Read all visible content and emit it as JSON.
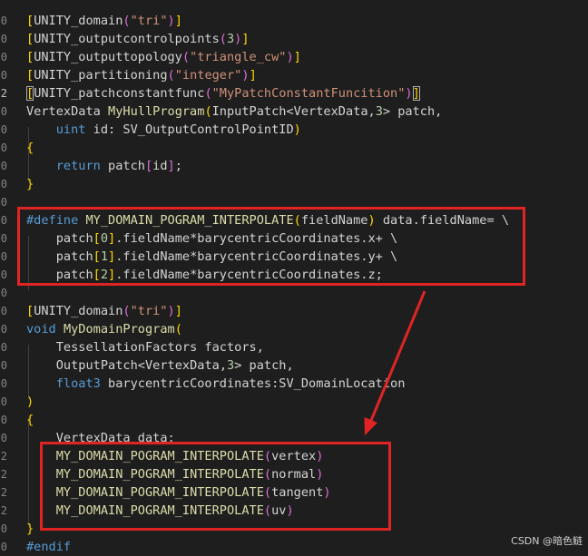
{
  "code_lines": [
    [
      [
        "[",
        "t-b1"
      ],
      [
        "UNITY_domain",
        "t-ident"
      ],
      [
        "(",
        "t-b2"
      ],
      [
        "\"tri\"",
        "t-str"
      ],
      [
        ")",
        "t-b2"
      ],
      [
        "]",
        "t-b1"
      ]
    ],
    [
      [
        "[",
        "t-b1"
      ],
      [
        "UNITY_outputcontrolpoints",
        "t-ident"
      ],
      [
        "(",
        "t-b2"
      ],
      [
        "3",
        "t-num"
      ],
      [
        ")",
        "t-b2"
      ],
      [
        "]",
        "t-b1"
      ]
    ],
    [
      [
        "[",
        "t-b1"
      ],
      [
        "UNITY_outputtopology",
        "t-ident"
      ],
      [
        "(",
        "t-b2"
      ],
      [
        "\"triangle_cw\"",
        "t-str"
      ],
      [
        ")",
        "t-b2"
      ],
      [
        "]",
        "t-b1"
      ]
    ],
    [
      [
        "[",
        "t-b1"
      ],
      [
        "UNITY_partitioning",
        "t-ident"
      ],
      [
        "(",
        "t-b2"
      ],
      [
        "\"integer\"",
        "t-str"
      ],
      [
        ")",
        "t-b2"
      ],
      [
        "]",
        "t-b1"
      ]
    ],
    [
      [
        "[",
        "t-b1 cursor-box"
      ],
      [
        "UNITY_patchconstantfunc",
        "t-ident"
      ],
      [
        "(",
        "t-b2"
      ],
      [
        "\"MyPatchConstantFuncition\"",
        "t-str"
      ],
      [
        ")",
        "t-b2"
      ],
      [
        "]",
        "t-b1 cursor-box"
      ]
    ],
    [
      [
        "VertexData ",
        "t-ident"
      ],
      [
        "MyHullProgram",
        "t-fn"
      ],
      [
        "(",
        "t-b1"
      ],
      [
        "InputPatch",
        "t-ident"
      ],
      [
        "<",
        "t-ident"
      ],
      [
        "VertexData",
        "t-ident"
      ],
      [
        ",",
        "t-ident"
      ],
      [
        "3",
        "t-num"
      ],
      [
        "> patch,",
        "t-ident"
      ]
    ],
    [
      [
        "    ",
        "t-ident"
      ],
      [
        "uint",
        "t-kw"
      ],
      [
        " id: SV_OutputControlPointID",
        "t-ident"
      ],
      [
        ")",
        "t-b1"
      ]
    ],
    [
      [
        "{",
        "t-b1"
      ]
    ],
    [
      [
        "    ",
        "t-ident"
      ],
      [
        "return",
        "t-kw"
      ],
      [
        " patch",
        "t-ident"
      ],
      [
        "[",
        "t-b2"
      ],
      [
        "id",
        "t-ident"
      ],
      [
        "]",
        "t-b2"
      ],
      [
        ";",
        "t-ident"
      ]
    ],
    [
      [
        "}",
        "t-b1"
      ]
    ],
    [],
    [
      [
        "#define",
        "t-macro"
      ],
      [
        " ",
        "t-ident"
      ],
      [
        "MY_DOMAIN_POGRAM_INTERPOLATE",
        "t-fn"
      ],
      [
        "(",
        "t-b1"
      ],
      [
        "fieldName",
        "t-ident"
      ],
      [
        ")",
        "t-b1"
      ],
      [
        " data.fieldName= \\",
        "t-ident"
      ]
    ],
    [
      [
        "    patch",
        "t-ident"
      ],
      [
        "[",
        "t-b1"
      ],
      [
        "0",
        "t-num"
      ],
      [
        "]",
        "t-b1"
      ],
      [
        ".fieldName*barycentricCoordinates.x+ \\",
        "t-ident"
      ]
    ],
    [
      [
        "    patch",
        "t-ident"
      ],
      [
        "[",
        "t-b1"
      ],
      [
        "1",
        "t-num"
      ],
      [
        "]",
        "t-b1"
      ],
      [
        ".fieldName*barycentricCoordinates.y+ \\",
        "t-ident"
      ]
    ],
    [
      [
        "    patch",
        "t-ident"
      ],
      [
        "[",
        "t-b1"
      ],
      [
        "2",
        "t-num"
      ],
      [
        "]",
        "t-b1"
      ],
      [
        ".fieldName*barycentricCoordinates.z;",
        "t-ident"
      ]
    ],
    [],
    [
      [
        "[",
        "t-b1"
      ],
      [
        "UNITY_domain",
        "t-ident"
      ],
      [
        "(",
        "t-b2"
      ],
      [
        "\"tri\"",
        "t-str"
      ],
      [
        ")",
        "t-b2"
      ],
      [
        "]",
        "t-b1"
      ]
    ],
    [
      [
        "void",
        "t-kw"
      ],
      [
        " ",
        "t-ident"
      ],
      [
        "MyDomainProgram",
        "t-fn"
      ],
      [
        "(",
        "t-b1"
      ]
    ],
    [
      [
        "    ",
        "t-ident"
      ],
      [
        "TessellationFactors factors,",
        "t-ident"
      ]
    ],
    [
      [
        "    ",
        "t-ident"
      ],
      [
        "OutputPatch",
        "t-ident"
      ],
      [
        "<",
        "t-ident"
      ],
      [
        "VertexData",
        "t-ident"
      ],
      [
        ",",
        "t-ident"
      ],
      [
        "3",
        "t-num"
      ],
      [
        "> patch,",
        "t-ident"
      ]
    ],
    [
      [
        "    ",
        "t-ident"
      ],
      [
        "float3",
        "t-kw"
      ],
      [
        " barycentricCoordinates:SV_DomainLocation",
        "t-ident"
      ]
    ],
    [
      [
        ")",
        "t-b1"
      ]
    ],
    [
      [
        "{",
        "t-b1"
      ]
    ],
    [
      [
        "    VertexData data;",
        "t-ident"
      ]
    ],
    [
      [
        "    ",
        "t-ident"
      ],
      [
        "MY_DOMAIN_POGRAM_INTERPOLATE",
        "t-fn"
      ],
      [
        "(",
        "t-b2"
      ],
      [
        "vertex",
        "t-ident"
      ],
      [
        ")",
        "t-b2"
      ]
    ],
    [
      [
        "    ",
        "t-ident"
      ],
      [
        "MY_DOMAIN_POGRAM_INTERPOLATE",
        "t-fn"
      ],
      [
        "(",
        "t-b2"
      ],
      [
        "normal",
        "t-ident"
      ],
      [
        ")",
        "t-b2"
      ]
    ],
    [
      [
        "    ",
        "t-ident"
      ],
      [
        "MY_DOMAIN_POGRAM_INTERPOLATE",
        "t-fn"
      ],
      [
        "(",
        "t-b2"
      ],
      [
        "tangent",
        "t-ident"
      ],
      [
        ")",
        "t-b2"
      ]
    ],
    [
      [
        "    ",
        "t-ident"
      ],
      [
        "MY_DOMAIN_POGRAM_INTERPOLATE",
        "t-fn"
      ],
      [
        "(",
        "t-b2"
      ],
      [
        "uv",
        "t-ident"
      ],
      [
        ")",
        "t-b2"
      ]
    ],
    [
      [
        "}",
        "t-b1"
      ]
    ],
    [
      [
        "#endif",
        "t-macro"
      ]
    ]
  ],
  "line_number_digits": [
    "0",
    "0",
    "0",
    "0",
    "2",
    "0",
    "0",
    "0",
    "0",
    "0",
    "0",
    "0",
    "0",
    "0",
    "0",
    "0",
    "0",
    "0",
    "0",
    "0",
    "0",
    "0",
    "0",
    "0",
    "2",
    "2",
    "2",
    "2",
    "0",
    "0"
  ],
  "active_line_index": 4,
  "watermark": "CSDN @暗色鲢",
  "colors": {
    "background": "#1e1e1e",
    "annotation": "#e02424"
  }
}
